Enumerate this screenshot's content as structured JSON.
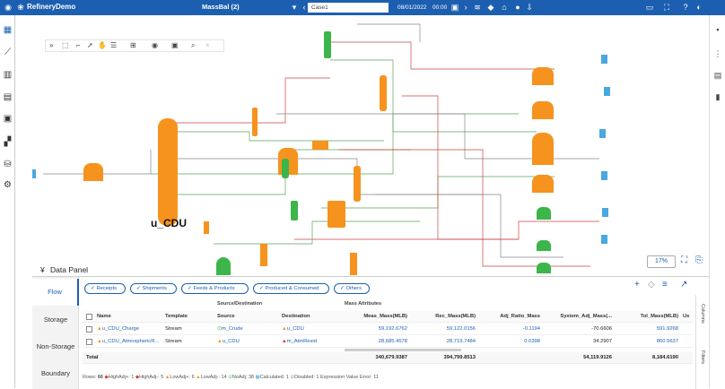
{
  "app": {
    "title": "RefineryDemo",
    "model": "MassBal (2)",
    "case": "Case1",
    "date": "08/01/2022",
    "time": "00:00"
  },
  "diagram": {
    "main_unit_label": "u_CDU",
    "zoom": "17%"
  },
  "data_panel": {
    "title": "Data Panel"
  },
  "side_tabs": [
    "Flow",
    "Storage",
    "Non-Storage",
    "Boundary"
  ],
  "filters": [
    "Receipts",
    "Shipments",
    "Feeds & Products",
    "Produced & Consumed",
    "Others"
  ],
  "table": {
    "group_headers": {
      "source_destination": "Source/Destination",
      "mass_attributes": "Mass Attributes"
    },
    "columns": [
      "Name",
      "Template",
      "Source",
      "Destination",
      "Meas_Mass(MLB)",
      "Rec_Mass(MLB)",
      "Adj_Ratio_Mass",
      "System_Adj_Mass(...",
      "Tol_Mass(MLB)",
      "Us"
    ],
    "rows": [
      {
        "name": "u_CDU_Charge",
        "template": "Stream",
        "source": "m_Crude",
        "destination": "u_CDU",
        "meas": "59,192.6762",
        "rec": "59,122.0156",
        "adj": "-0.1194",
        "sys": "-70.6606",
        "tol": "591.9268"
      },
      {
        "name": "u_CDU_AtmosphericR...",
        "template": "Stream",
        "source": "u_CDU",
        "destination": "m_AtmResid",
        "meas": "28,685.4578",
        "rec": "28,719.7484",
        "adj": "0.0398",
        "sys": "34.2907",
        "tol": "860.5637"
      }
    ],
    "total": {
      "label": "Total",
      "meas": "340,679.9387",
      "rec": "394,799.8513",
      "sys": "54,119.9126",
      "tol": "8,184.6190"
    }
  },
  "status": {
    "rows_label": "Rows:",
    "rows": "66",
    "high_adj_plus": "HighAdj+: 1",
    "high_adj": "HighAdj-: 5",
    "low_adj_plus": "LowAdj+: 6",
    "low_adj": "LowAdj-: 14",
    "no_adj": "NoAdj: 38",
    "calculated": "Calculated: 1",
    "disabled": "Disabled: 1",
    "expr_error": "Expression Value Error: 11"
  },
  "right_vtabs": [
    "Columns",
    "Filters"
  ],
  "colors": {
    "brand": "#1c5fb0",
    "unit": "#f6931e",
    "valve": "#3cb54a",
    "tank": "#4aa8e0"
  }
}
